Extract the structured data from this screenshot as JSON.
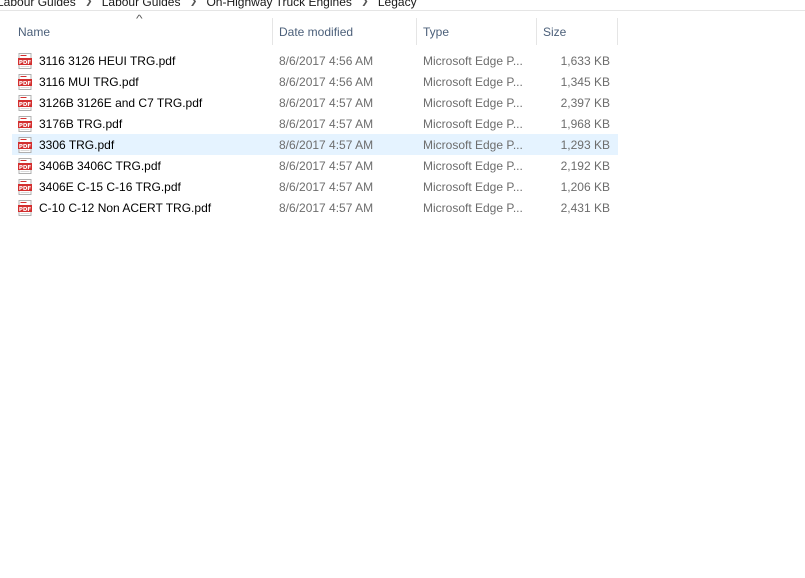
{
  "breadcrumb": {
    "items": [
      "Labour Guides",
      "Labour Guides",
      "On-Highway Truck Engines",
      "Legacy"
    ]
  },
  "columns": {
    "name": "Name",
    "date": "Date modified",
    "type": "Type",
    "size": "Size"
  },
  "files": [
    {
      "name": "3116 3126 HEUI TRG.pdf",
      "date": "8/6/2017 4:56 AM",
      "type": "Microsoft Edge P...",
      "size": "1,633 KB"
    },
    {
      "name": "3116 MUI TRG.pdf",
      "date": "8/6/2017 4:56 AM",
      "type": "Microsoft Edge P...",
      "size": "1,345 KB"
    },
    {
      "name": "3126B 3126E and C7 TRG.pdf",
      "date": "8/6/2017 4:57 AM",
      "type": "Microsoft Edge P...",
      "size": "2,397 KB"
    },
    {
      "name": "3176B TRG.pdf",
      "date": "8/6/2017 4:57 AM",
      "type": "Microsoft Edge P...",
      "size": "1,968 KB"
    },
    {
      "name": "3306 TRG.pdf",
      "date": "8/6/2017 4:57 AM",
      "type": "Microsoft Edge P...",
      "size": "1,293 KB"
    },
    {
      "name": "3406B 3406C TRG.pdf",
      "date": "8/6/2017 4:57 AM",
      "type": "Microsoft Edge P...",
      "size": "2,192 KB"
    },
    {
      "name": "3406E C-15 C-16 TRG.pdf",
      "date": "8/6/2017 4:57 AM",
      "type": "Microsoft Edge P...",
      "size": "1,206 KB"
    },
    {
      "name": "C-10 C-12 Non ACERT TRG.pdf",
      "date": "8/6/2017 4:57 AM",
      "type": "Microsoft Edge P...",
      "size": "2,431 KB"
    }
  ],
  "icons": {
    "file": "pdf-file-icon",
    "sort": "sort-ascending-icon",
    "separator": "chevron-right-icon"
  },
  "colors": {
    "selected_row": "#e5f3ff",
    "header_text": "#4c607a",
    "pdf_icon": "#d32f2f"
  }
}
